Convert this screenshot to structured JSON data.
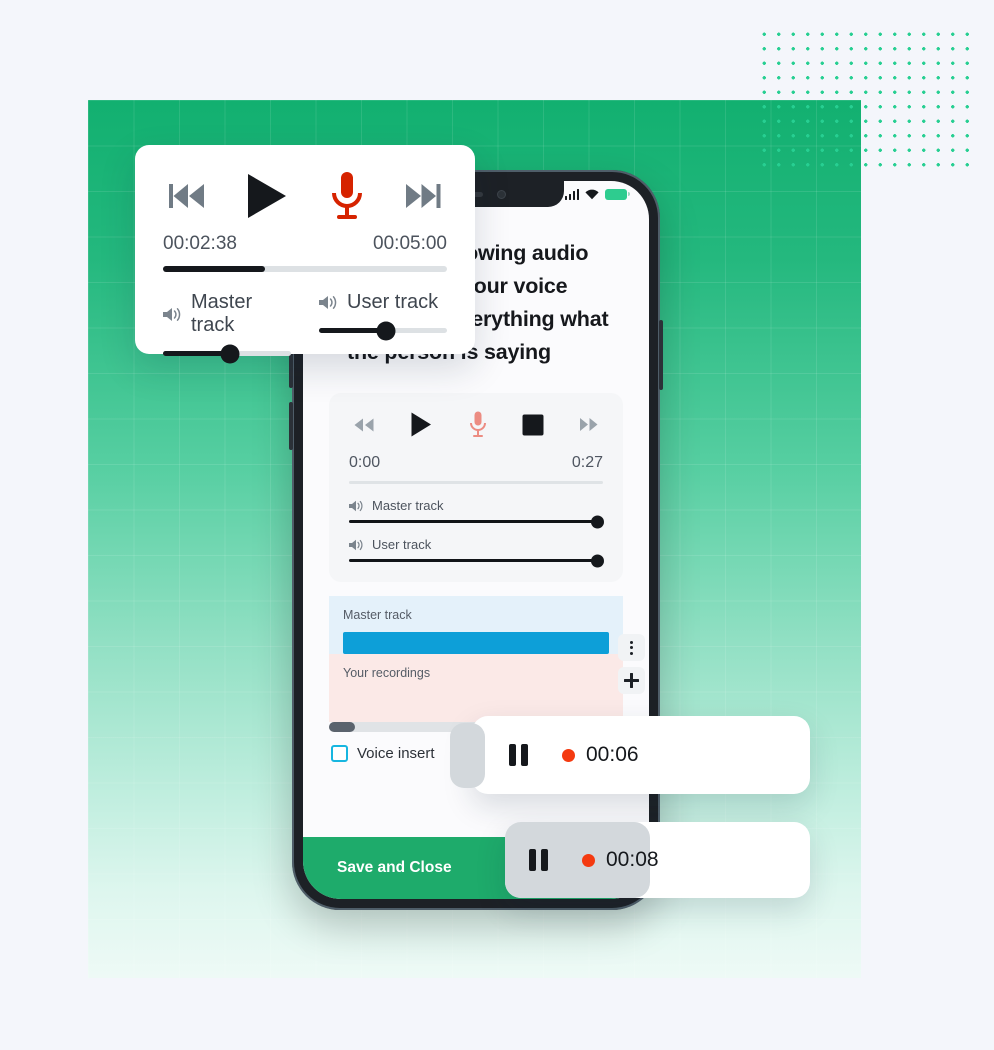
{
  "theme": {
    "page_bg": "#f4f6fb",
    "panel_green_top": "#12b070",
    "panel_green_bottom": "#eefaf6",
    "dot_color": "#27cf92",
    "accent_red": "#d62300",
    "accent_blue": "#0d9fd8",
    "accent_cyan": "#17b6e0",
    "save_bar_green": "#1eab6b",
    "record_dot": "#f43a10"
  },
  "phone": {
    "status_bar": {
      "signal_icon": "cellular-signal-icon",
      "wifi_icon": "wifi-icon",
      "battery_icon": "battery-icon",
      "battery_color": "#2ecc8f"
    },
    "headline": "Play the following audio and record your voice repeating everything what the person is saying",
    "headline_lines": [
      "Play the following audio",
      "and record your voice",
      "repeating everything what",
      "the person is saying"
    ],
    "inner_player": {
      "controls": [
        {
          "name": "rewind-icon",
          "glyph": "rewind"
        },
        {
          "name": "play-icon",
          "glyph": "play"
        },
        {
          "name": "microphone-icon",
          "glyph": "mic"
        },
        {
          "name": "stop-icon",
          "glyph": "stop"
        },
        {
          "name": "fast-forward-icon",
          "glyph": "forward"
        }
      ],
      "current_time": "0:00",
      "total_time": "0:27",
      "progress_percent": 0,
      "volumes": [
        {
          "label": "Master track",
          "value_percent": 100,
          "icon": "volume-icon"
        },
        {
          "label": "User track",
          "value_percent": 100,
          "icon": "volume-icon"
        }
      ]
    },
    "tracklist": {
      "rows": [
        {
          "name": "Master track",
          "type": "master",
          "has_waveform": true
        },
        {
          "name": "Your recordings",
          "type": "user",
          "has_waveform": false
        }
      ],
      "actions": [
        {
          "name": "more-options-button",
          "glyph": "vertical-dots"
        },
        {
          "name": "add-track-button",
          "glyph": "plus"
        }
      ],
      "scroll_position_percent": 0
    },
    "voice_insert": {
      "label": "Voice insert",
      "checked": false
    },
    "save_bar": {
      "label": "Save and Close"
    }
  },
  "floating_player": {
    "controls": [
      {
        "name": "previous-track-icon",
        "glyph": "prev"
      },
      {
        "name": "play-icon",
        "glyph": "play"
      },
      {
        "name": "microphone-record-icon",
        "glyph": "mic"
      },
      {
        "name": "next-track-icon",
        "glyph": "next"
      }
    ],
    "current_time": "00:02:38",
    "total_time": "00:05:00",
    "progress_percent": 36,
    "volumes": [
      {
        "label": "Master track",
        "value_percent": 52,
        "icon": "volume-icon"
      },
      {
        "label": "User track",
        "value_percent": 52,
        "icon": "volume-icon"
      }
    ]
  },
  "recording_pills": [
    {
      "id": "pill-1",
      "pause_icon": "pause-icon",
      "record_indicator": "record-dot-icon",
      "time": "00:06"
    },
    {
      "id": "pill-2",
      "pause_icon": "pause-icon",
      "record_indicator": "record-dot-icon",
      "time": "00:08"
    }
  ]
}
